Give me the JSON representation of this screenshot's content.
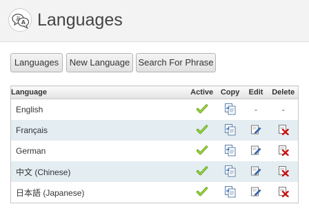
{
  "header": {
    "title": "Languages",
    "logo_icon": "translate-bubbles-icon"
  },
  "toolbar": {
    "languages_label": "Languages",
    "new_language_label": "New Language",
    "search_label": "Search For Phrase"
  },
  "table": {
    "columns": {
      "language": "Language",
      "active": "Active",
      "copy": "Copy",
      "edit": "Edit",
      "delete": "Delete"
    },
    "rows": [
      {
        "name": "English",
        "active": true,
        "copy": true,
        "edit": "-",
        "delete": "-"
      },
      {
        "name": "Français",
        "active": true,
        "copy": true,
        "edit": "edit",
        "delete": "delete"
      },
      {
        "name": "German",
        "active": true,
        "copy": true,
        "edit": "edit",
        "delete": "delete"
      },
      {
        "name": "中文 (Chinese)",
        "active": true,
        "copy": true,
        "edit": "edit",
        "delete": "delete"
      },
      {
        "name": "日本語 (Japanese)",
        "active": true,
        "copy": true,
        "edit": "edit",
        "delete": "delete"
      }
    ]
  },
  "icons": {
    "active": "green-checkmark-icon",
    "copy": "copy-pages-icon",
    "edit": "pencil-edit-icon",
    "delete": "delete-x-icon"
  },
  "colors": {
    "row_alt": "#e3edf2",
    "check": "#7cbf1e",
    "delete": "#cc1111"
  }
}
